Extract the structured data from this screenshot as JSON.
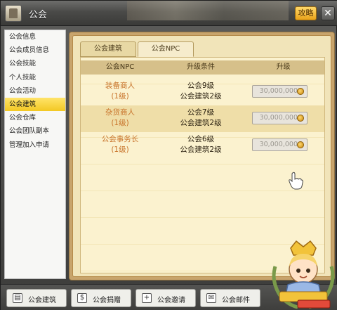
{
  "window": {
    "title": "公会",
    "guide_label": "攻略",
    "close_label": "✕"
  },
  "sidebar": {
    "items": [
      {
        "label": "公会信息",
        "active": false
      },
      {
        "label": "公会成员信息",
        "active": false
      },
      {
        "label": "公会技能",
        "active": false
      },
      {
        "label": "个人技能",
        "active": false
      },
      {
        "label": "公会活动",
        "active": false
      },
      {
        "label": "公会建筑",
        "active": true
      },
      {
        "label": "公会仓库",
        "active": false
      },
      {
        "label": "公会团队副本",
        "active": false
      },
      {
        "label": "管理加入申请",
        "active": false
      }
    ]
  },
  "tabs": [
    {
      "label": "公会建筑",
      "active": false
    },
    {
      "label": "公会NPC",
      "active": true
    }
  ],
  "table": {
    "headers": [
      "公会NPC",
      "升级条件",
      "升级"
    ],
    "rows": [
      {
        "name": "装备商人",
        "level": "(1级)",
        "cond1": "公会9级",
        "cond2": "公会建筑2级",
        "cost": "30,000,000"
      },
      {
        "name": "杂货商人",
        "level": "(1级)",
        "cond1": "公会7级",
        "cond2": "公会建筑2级",
        "cost": "30,000,000"
      },
      {
        "name": "公会事务长",
        "level": "(1级)",
        "cond1": "公会6级",
        "cond2": "公会建筑2级",
        "cost": "30,000,000"
      }
    ]
  },
  "bottom_bar": {
    "buttons": [
      {
        "label": "公会建筑",
        "icon": "building-icon"
      },
      {
        "label": "公会捐赠",
        "icon": "donate-icon"
      },
      {
        "label": "公会邀请",
        "icon": "plus-icon"
      },
      {
        "label": "公会邮件",
        "icon": "mail-icon"
      }
    ]
  },
  "colors": {
    "active_sidebar": "#f3c823",
    "npc_name": "#c8732a",
    "panel_bg": "#f1e4b9"
  }
}
